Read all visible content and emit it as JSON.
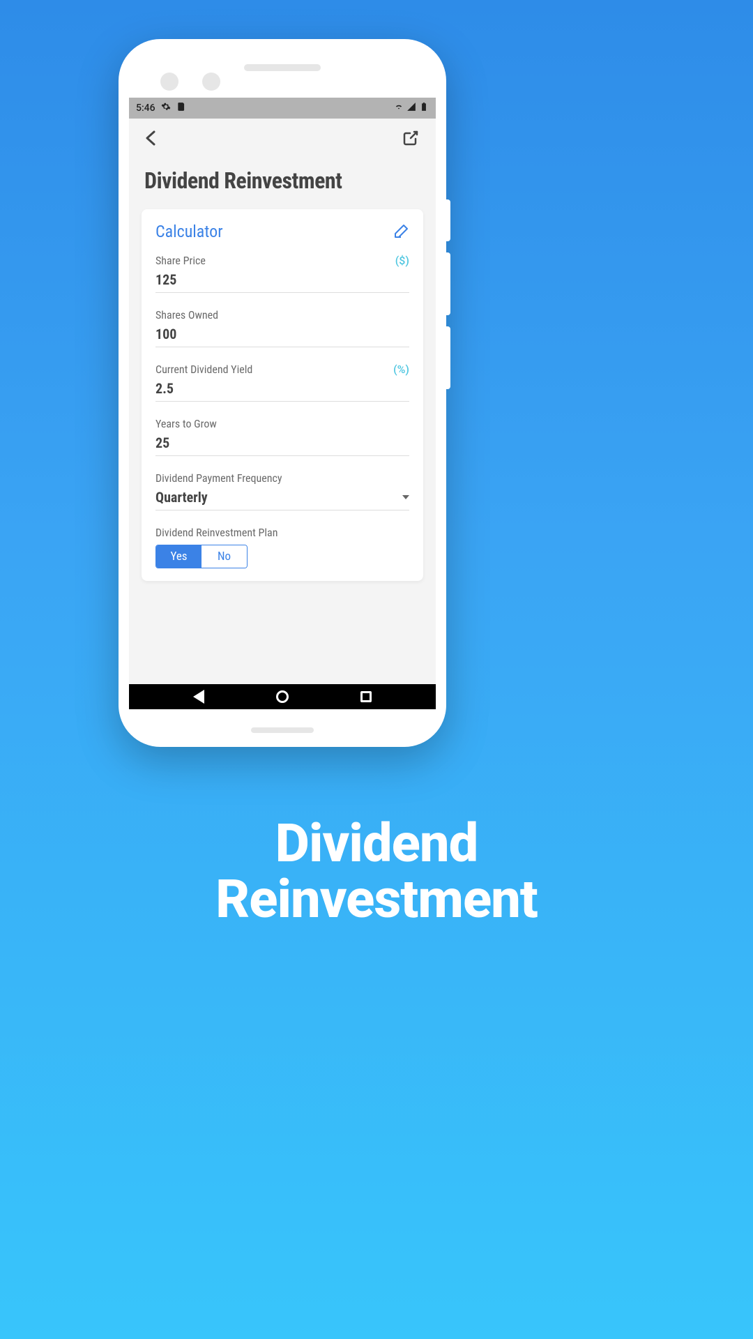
{
  "status": {
    "time": "5:46",
    "gear_icon": "gear",
    "sd_icon": "sd",
    "wifi_icon": "wifi",
    "signal_icon": "signal",
    "battery_icon": "battery"
  },
  "header": {
    "title": "Dividend Reinvestment"
  },
  "card": {
    "title": "Calculator",
    "fields": {
      "share_price": {
        "label": "Share Price",
        "unit": "($)",
        "value": "125"
      },
      "shares_owned": {
        "label": "Shares Owned",
        "value": "100"
      },
      "dividend_yield": {
        "label": "Current Dividend Yield",
        "unit": "(%)",
        "value": "2.5"
      },
      "years": {
        "label": "Years to Grow",
        "value": "25"
      },
      "frequency": {
        "label": "Dividend Payment Frequency",
        "value": "Quarterly"
      },
      "drip": {
        "label": "Dividend Reinvestment Plan",
        "yes": "Yes",
        "no": "No",
        "selected": "Yes"
      }
    }
  },
  "caption": {
    "line1": "Dividend",
    "line2": "Reinvestment"
  }
}
